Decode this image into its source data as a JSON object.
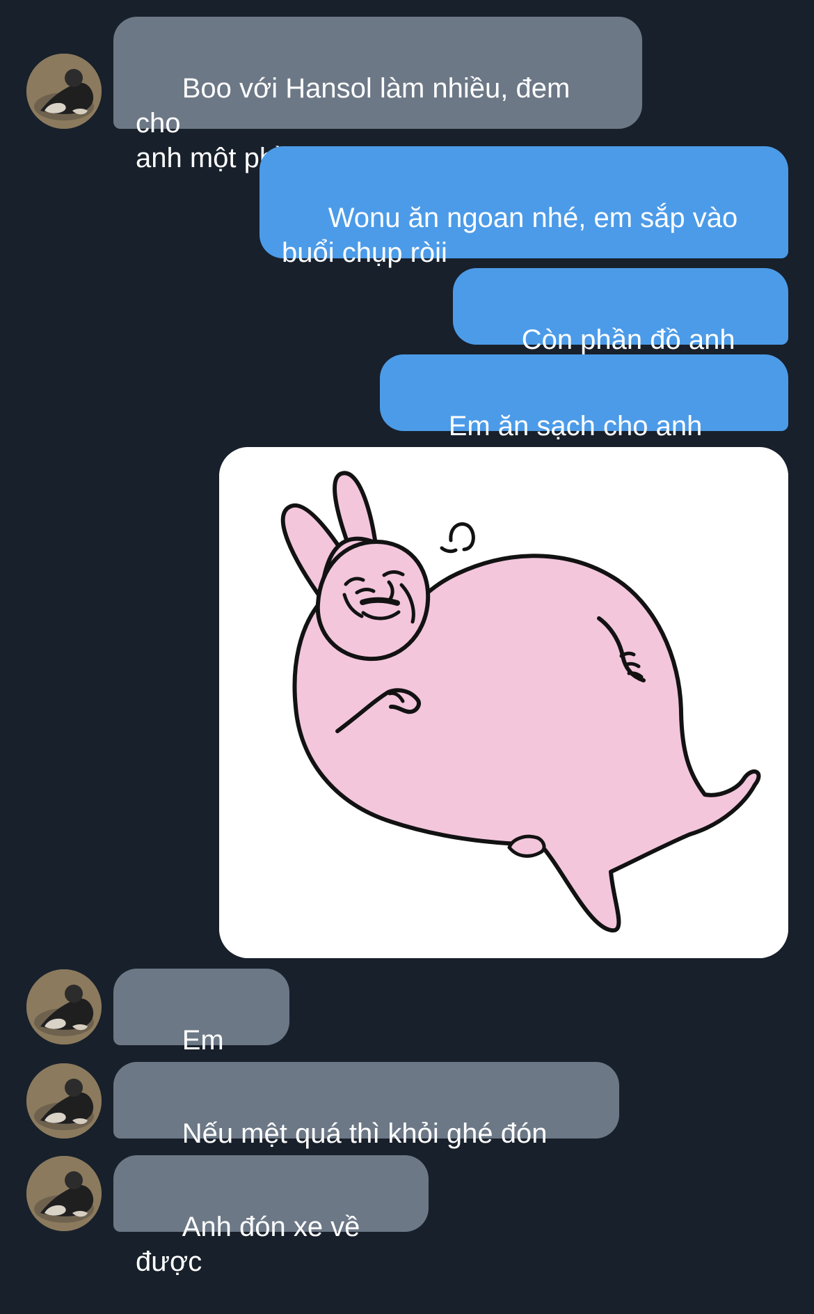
{
  "messages": [
    {
      "text": "Boo với Hansol làm nhiều, đem cho\nanh một phần này",
      "direction": "incoming"
    },
    {
      "text": "Wonu ăn ngoan nhé, em sắp vào\nbuổi chụp ròii",
      "direction": "outgoing"
    },
    {
      "text": "Còn phần đồ anh nấu",
      "direction": "outgoing"
    },
    {
      "text": "Em ăn sạch cho anh xemm",
      "direction": "outgoing"
    },
    {
      "sticker": "pink-bunny-sticker",
      "direction": "outgoing"
    },
    {
      "text": "Em làm đi",
      "direction": "incoming"
    },
    {
      "text": "Nếu mệt quá thì khỏi ghé đón anh",
      "direction": "incoming"
    },
    {
      "text": "Anh đón xe về được",
      "direction": "incoming"
    }
  ],
  "colors": {
    "background": "#18202b",
    "incoming_bubble": "#6c7886",
    "outgoing_bubble": "#4c9be8",
    "text": "#ffffff",
    "sticker_bubble": "#ffffff",
    "bunny_pink": "#f3c6dc",
    "bunny_outline": "#121212"
  },
  "icons": {
    "contact_avatar": "avatar-photo",
    "sticker": "pink-bunny-sticker"
  }
}
